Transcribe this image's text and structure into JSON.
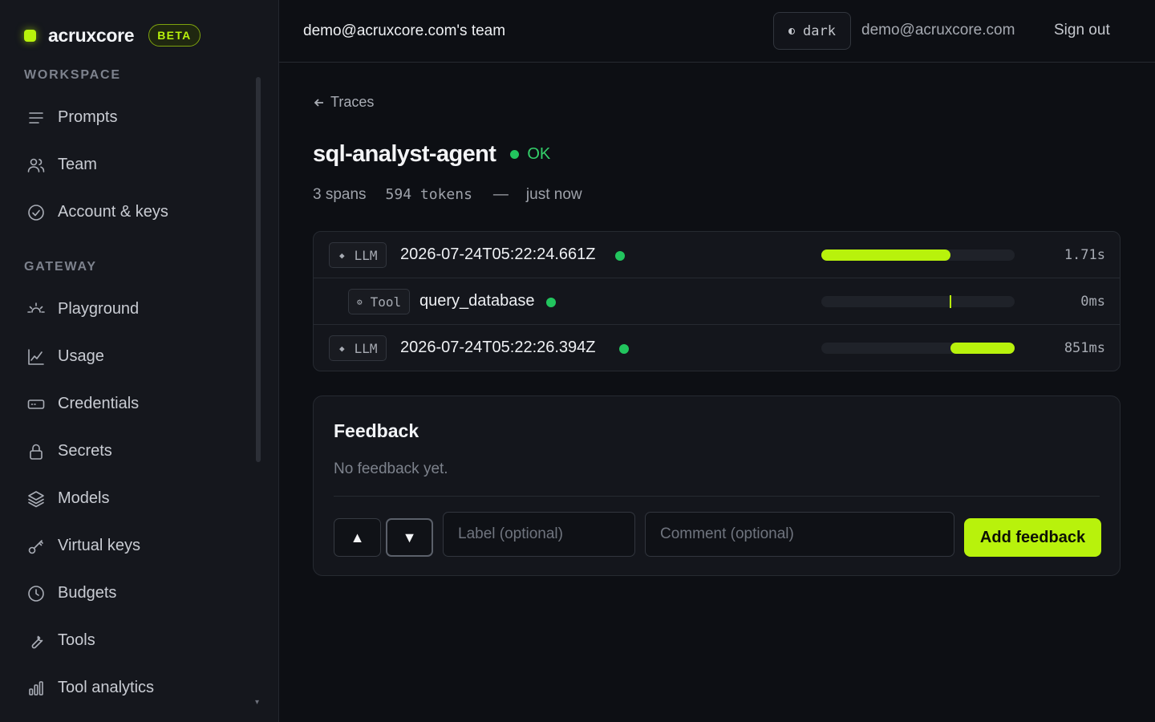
{
  "brand": {
    "name": "acruxcore",
    "badge": "BETA"
  },
  "sidebar": {
    "sections": [
      {
        "label": "WORKSPACE",
        "items": [
          {
            "label": "Prompts",
            "icon": "lines-icon"
          },
          {
            "label": "Team",
            "icon": "users-icon"
          },
          {
            "label": "Account & keys",
            "icon": "check-circle-icon"
          }
        ]
      },
      {
        "label": "GATEWAY",
        "items": [
          {
            "label": "Playground",
            "icon": "sun-icon"
          },
          {
            "label": "Usage",
            "icon": "line-chart-icon"
          },
          {
            "label": "Credentials",
            "icon": "card-icon"
          },
          {
            "label": "Secrets",
            "icon": "lock-icon"
          },
          {
            "label": "Models",
            "icon": "layers-icon"
          },
          {
            "label": "Virtual keys",
            "icon": "key-icon"
          },
          {
            "label": "Budgets",
            "icon": "clock-icon"
          },
          {
            "label": "Tools",
            "icon": "wrench-icon"
          },
          {
            "label": "Tool analytics",
            "icon": "bar-chart-icon"
          }
        ]
      }
    ]
  },
  "header": {
    "team": "demo@acruxcore.com's team",
    "theme_label": "dark",
    "email": "demo@acruxcore.com",
    "signout": "Sign out"
  },
  "trace": {
    "back_label": "Traces",
    "title": "sql-analyst-agent",
    "status": "OK",
    "span_count": "3 spans",
    "tokens": "594 tokens",
    "separator": "—",
    "time": "just now",
    "spans": [
      {
        "kind": "LLM",
        "name": "2026-07-24T05:22:24.661Z",
        "duration": "1.71s",
        "start": 0.0,
        "end": 0.67,
        "nested": false
      },
      {
        "kind": "Tool",
        "name": "query_database",
        "duration": "0ms",
        "start": 0.67,
        "end": 0.67,
        "nested": true
      },
      {
        "kind": "LLM",
        "name": "2026-07-24T05:22:26.394Z",
        "duration": "851ms",
        "start": 0.67,
        "end": 1.0,
        "nested": false
      }
    ]
  },
  "feedback": {
    "title": "Feedback",
    "empty": "No feedback yet.",
    "label_placeholder": "Label (optional)",
    "comment_placeholder": "Comment (optional)",
    "add_label": "Add feedback",
    "up_glyph": "▲",
    "down_glyph": "▼"
  },
  "colors": {
    "accent": "#b8f20c",
    "ok": "#22c55e",
    "bg": "#0d0f14",
    "sidebar": "#15171d"
  }
}
